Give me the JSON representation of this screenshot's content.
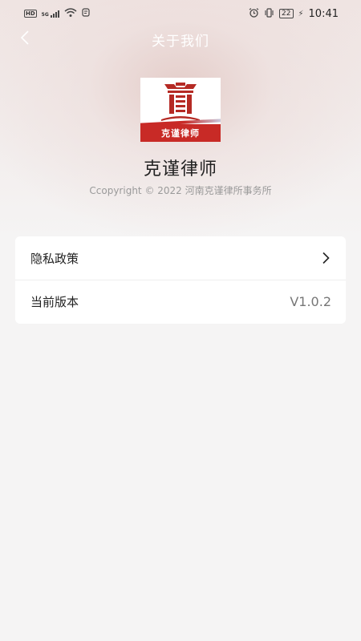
{
  "status_bar": {
    "network_badge": "HD",
    "network_type": "5G",
    "battery": "22",
    "time": "10:41"
  },
  "nav": {
    "title": "关于我们"
  },
  "about": {
    "logo_text": "克谨律师",
    "app_name": "克谨律师",
    "copyright": "Ccopyright © 2022 河南克谨律所事务所"
  },
  "settings": {
    "privacy_label": "隐私政策",
    "version_label": "当前版本",
    "version_value": "V1.0.2"
  },
  "colors": {
    "brand_red": "#c82a26",
    "background": "#f5f4f4"
  }
}
